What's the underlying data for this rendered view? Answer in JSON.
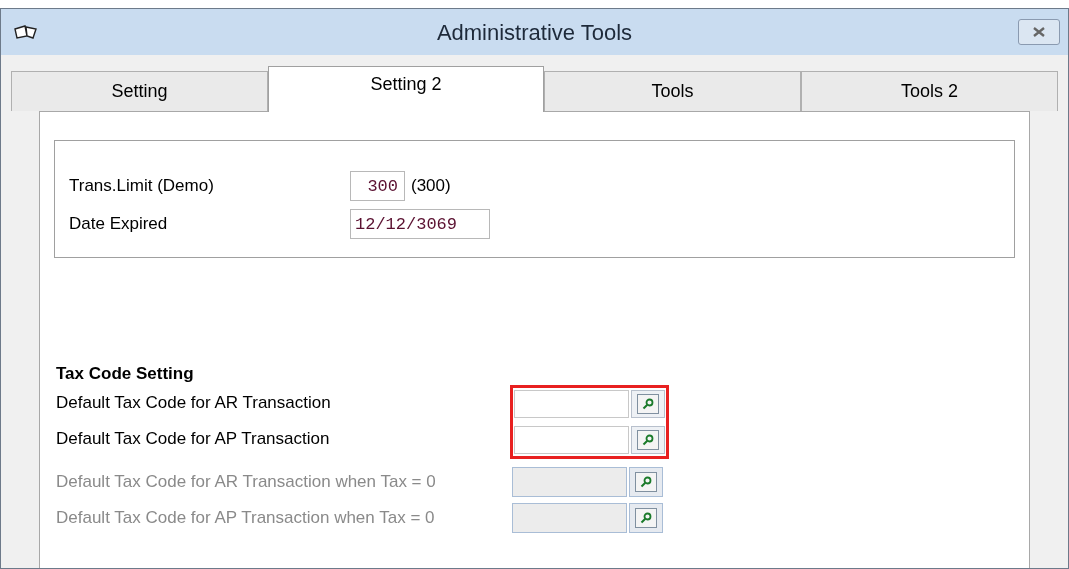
{
  "window": {
    "title": "Administrative Tools"
  },
  "tabs": [
    {
      "label": "Setting",
      "selected": false
    },
    {
      "label": "Setting 2",
      "selected": true
    },
    {
      "label": "Tools",
      "selected": false
    },
    {
      "label": "Tools 2",
      "selected": false
    }
  ],
  "demo_group": {
    "trans_limit": {
      "label": "Trans.Limit (Demo)",
      "value": "300",
      "note": "(300)"
    },
    "date_expired": {
      "label": "Date Expired",
      "value": "12/12/3069"
    }
  },
  "tax_code_setting": {
    "heading": "Tax Code Setting",
    "rows": [
      {
        "label": "Default Tax Code for AR Transaction",
        "disabled": false,
        "highlighted": true
      },
      {
        "label": "Default Tax Code for AP Transaction",
        "disabled": false,
        "highlighted": true
      },
      {
        "label": "Default Tax Code for AR Transaction when Tax = 0",
        "disabled": true,
        "highlighted": false
      },
      {
        "label": "Default Tax Code for AP Transaction when Tax = 0",
        "disabled": true,
        "highlighted": false
      }
    ]
  }
}
